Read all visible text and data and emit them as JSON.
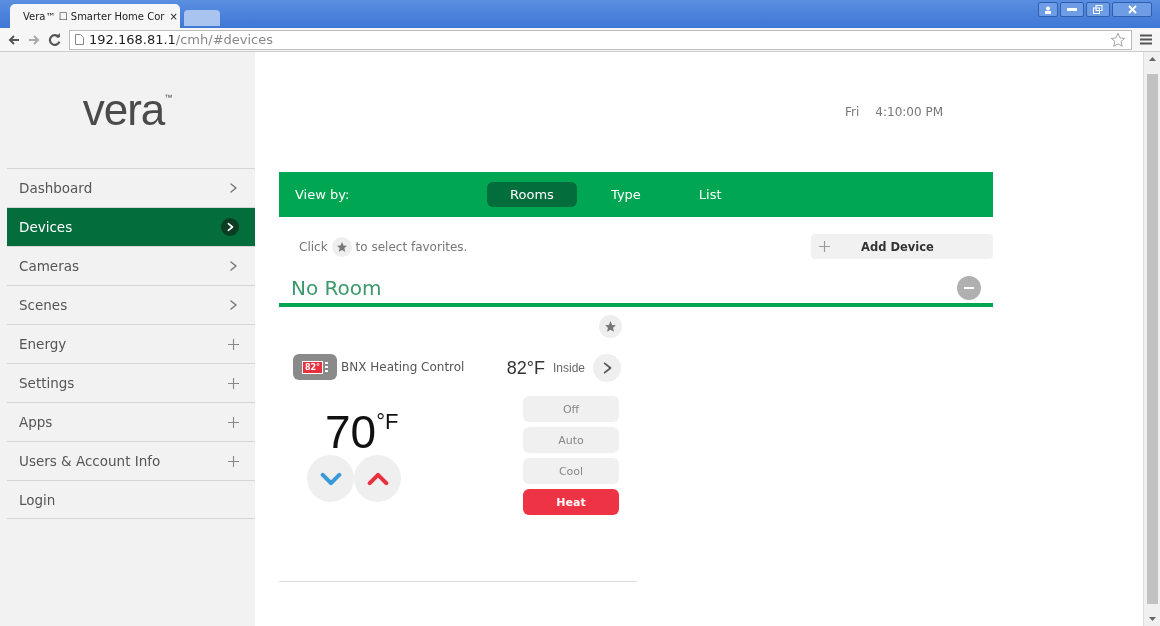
{
  "browser": {
    "tab_title": "Vera™ ☐ Smarter Home Cor",
    "tab_close": "×",
    "url_host": "192.168.81.1",
    "url_path": "/cmh/#devices"
  },
  "logo": {
    "text": "vera",
    "mark": "™"
  },
  "sidebar": {
    "items": [
      {
        "label": "Dashboard",
        "kind": "arrow",
        "selected": false
      },
      {
        "label": "Devices",
        "kind": "arrow",
        "selected": true
      },
      {
        "label": "Cameras",
        "kind": "arrow",
        "selected": false
      },
      {
        "label": "Scenes",
        "kind": "arrow",
        "selected": false
      },
      {
        "label": "Energy",
        "kind": "plus",
        "selected": false
      },
      {
        "label": "Settings",
        "kind": "plus",
        "selected": false
      },
      {
        "label": "Apps",
        "kind": "plus",
        "selected": false
      },
      {
        "label": "Users & Account Info",
        "kind": "plus",
        "selected": false
      },
      {
        "label": "Login",
        "kind": "none",
        "selected": false
      }
    ]
  },
  "clock": {
    "day": "Fri",
    "time": "4:10:00 PM"
  },
  "view_bar": {
    "label": "View by:",
    "tabs": [
      {
        "label": "Rooms",
        "selected": true
      },
      {
        "label": "Type",
        "selected": false
      },
      {
        "label": "List",
        "selected": false
      }
    ]
  },
  "hint": {
    "before": "Click",
    "after": "to select favorites."
  },
  "add_device": {
    "label": "Add Device"
  },
  "room": {
    "name": "No Room",
    "expanded": true
  },
  "device": {
    "favorite": false,
    "icon_reading": "82°",
    "name": "BNX Heating Control",
    "inside_value": "82°F",
    "inside_label": "Inside",
    "setpoint": "70",
    "setpoint_unit": "°F",
    "modes": [
      {
        "label": "Off",
        "selected": false
      },
      {
        "label": "Auto",
        "selected": false
      },
      {
        "label": "Cool",
        "selected": false
      },
      {
        "label": "Heat",
        "selected": true
      }
    ]
  }
}
